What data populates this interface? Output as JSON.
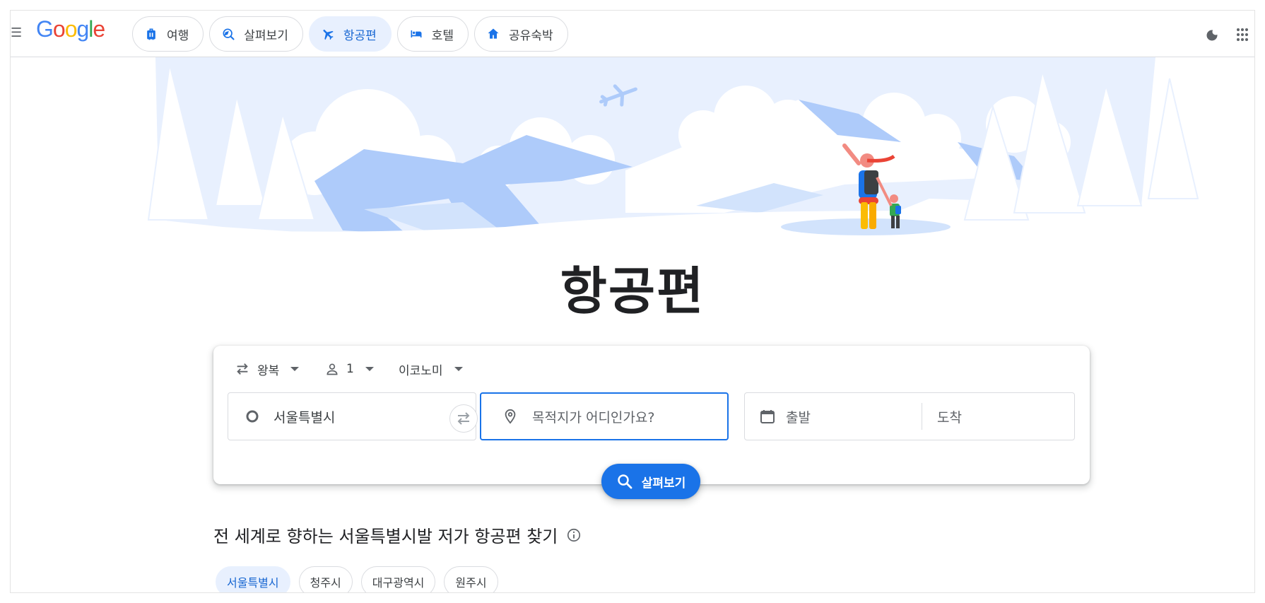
{
  "header": {
    "logo": "Google",
    "tabs": [
      {
        "label": "여행",
        "icon": "luggage-icon"
      },
      {
        "label": "살펴보기",
        "icon": "explore-icon"
      },
      {
        "label": "항공편",
        "icon": "flight-icon",
        "active": true
      },
      {
        "label": "호텔",
        "icon": "bed-icon"
      },
      {
        "label": "공유숙박",
        "icon": "home-icon"
      }
    ]
  },
  "main": {
    "title": "항공편"
  },
  "search": {
    "trip_type": "왕복",
    "passengers": "1",
    "cabin_class": "이코노미",
    "origin": "서울특별시",
    "destination_placeholder": "목적지가 어디인가요?",
    "depart_placeholder": "출발",
    "return_placeholder": "도착",
    "search_label": "살펴보기"
  },
  "explore": {
    "heading": "전 세계로 향하는 서울특별시발 저가 항공편 찾기",
    "chips": [
      "서울특별시",
      "청주시",
      "대구광역시",
      "원주시"
    ]
  },
  "colors": {
    "accent": "#1a73e8",
    "active_chip_bg": "#e8f0fe",
    "hero_light": "#e8f0fe",
    "hero_mid": "#aecbfa"
  }
}
